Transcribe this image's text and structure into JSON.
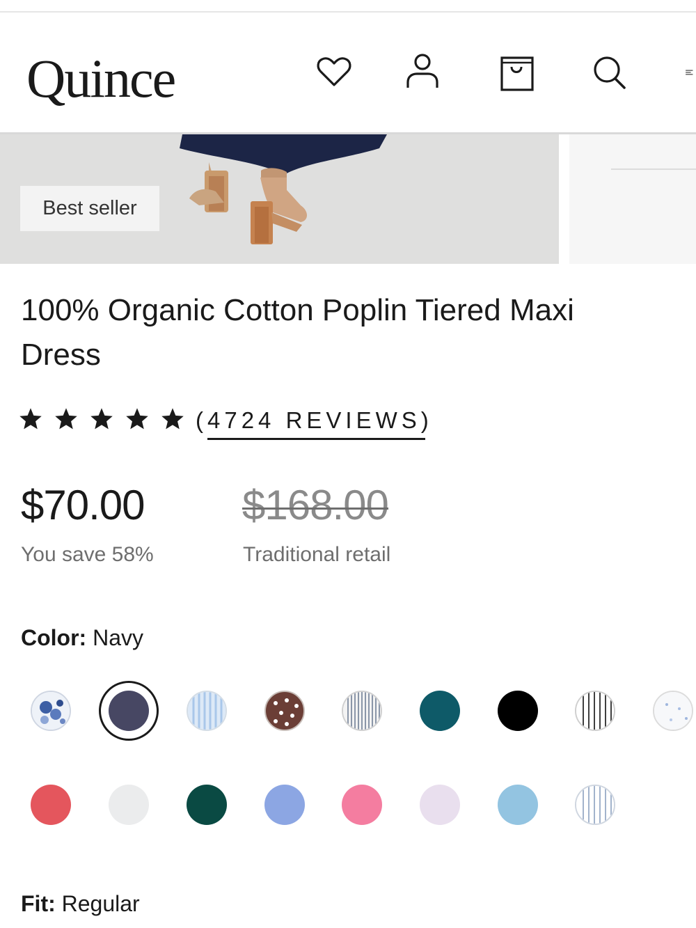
{
  "header": {
    "logo": "Quince",
    "icons": [
      "heart-icon",
      "user-icon",
      "bag-icon",
      "search-icon",
      "menu-icon"
    ]
  },
  "hero": {
    "badge": "Best seller"
  },
  "product": {
    "title": "100% Organic Cotton Poplin Tiered Maxi Dress",
    "rating_stars": 5,
    "reviews_open": "(",
    "reviews_text": "4724 REVIEWS",
    "reviews_close": ")",
    "price": "$70.00",
    "savings": "You save 58%",
    "original_price": "$168.00",
    "original_label": "Traditional retail"
  },
  "color": {
    "label": "Color:",
    "selected": "Navy",
    "swatches_row1": [
      "floral-blue",
      "navy",
      "blue-stripe",
      "brown-dot",
      "gray-stripe",
      "teal",
      "black",
      "black-stripe",
      "white-print"
    ],
    "swatches_row2": [
      "coral-red",
      "light-gray",
      "dark-green",
      "periwinkle",
      "pink",
      "lavender",
      "sky-blue",
      "blue-white-stripe"
    ],
    "colors": {
      "navy": "#474763",
      "teal": "#0e5a68",
      "black": "#000000",
      "coral-red": "#e4565d",
      "light-gray": "#ebeced",
      "dark-green": "#0a4a43",
      "periwinkle": "#8ca6e3",
      "pink": "#f47da0",
      "lavender": "#e9dfee",
      "sky-blue": "#93c4e1"
    }
  },
  "fit": {
    "label": "Fit:",
    "value": "Regular"
  }
}
